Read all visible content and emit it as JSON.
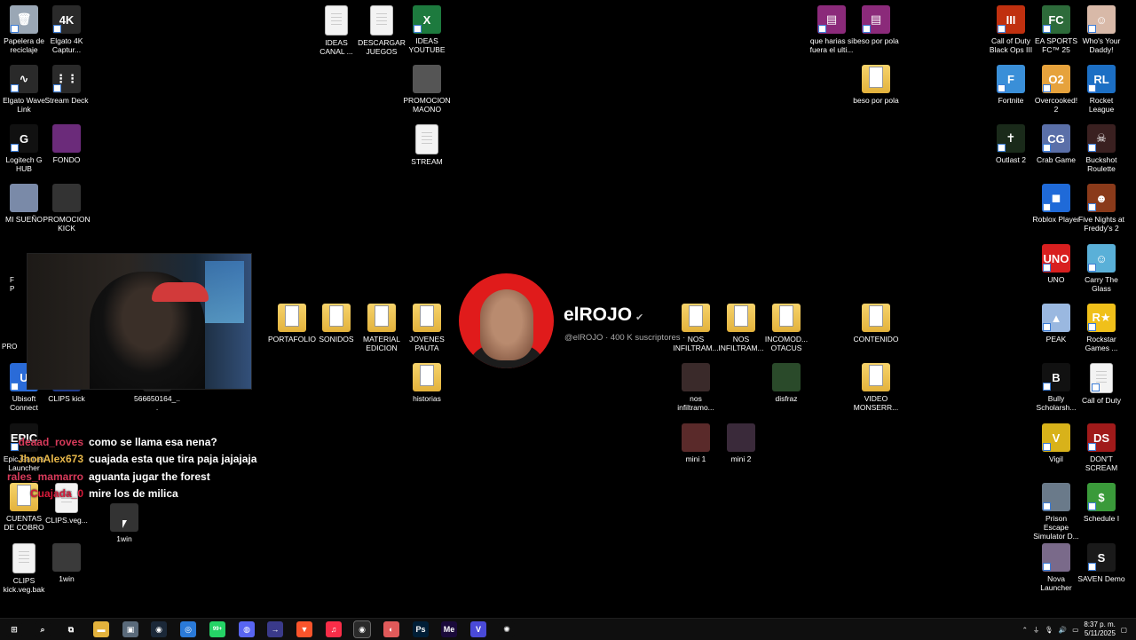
{
  "desktop_icons": [
    {
      "id": "recycle",
      "label": "Papelera de reciclaje",
      "icon": "recycle-bin-icon",
      "color": "#9aa7b5",
      "glyph": "🗑"
    },
    {
      "id": "elgato4k",
      "label": "Elgato 4K Captur...",
      "icon": "elgato-4k-icon",
      "color": "#2a2a2a",
      "glyph": "4K"
    },
    {
      "id": "ideascanal",
      "label": "IDEAS CANAL ...",
      "icon": "text-document-icon",
      "color": "#f3f3f3",
      "glyph": ""
    },
    {
      "id": "descargar",
      "label": "DESCARGAR JUEGOS",
      "icon": "text-document-icon",
      "color": "#f3f3f3",
      "glyph": ""
    },
    {
      "id": "ideasyt",
      "label": "IDEAS YOUTUBE",
      "icon": "excel-icon",
      "color": "#1d7a3e",
      "glyph": "X"
    },
    {
      "id": "quehar",
      "label": "que harias si fuera el ulti...",
      "icon": "winrar-icon",
      "color": "#8b2a7a",
      "glyph": "▤"
    },
    {
      "id": "beso1",
      "label": "beso por pola",
      "icon": "winrar-icon",
      "color": "#8b2a7a",
      "glyph": "▤"
    },
    {
      "id": "cod",
      "label": "Call of Duty Black Ops III",
      "icon": "cod-icon",
      "color": "#c0300f",
      "glyph": "III"
    },
    {
      "id": "easports",
      "label": "EA SPORTS FC™ 25",
      "icon": "ea-fc-icon",
      "color": "#2d6b3a",
      "glyph": "FC"
    },
    {
      "id": "whosdaddy",
      "label": "Who's Your Daddy!",
      "icon": "whos-daddy-icon",
      "color": "#d8b9a8",
      "glyph": "☺"
    },
    {
      "id": "wave",
      "label": "Elgato Wave Link",
      "icon": "elgato-wave-icon",
      "color": "#2a2a2a",
      "glyph": "∿"
    },
    {
      "id": "streamdeck",
      "label": "Stream Deck",
      "icon": "stream-deck-icon",
      "color": "#2a2a2a",
      "glyph": "⋮⋮"
    },
    {
      "id": "promomaono",
      "label": "PROMOCION MAONO",
      "icon": "video-icon",
      "color": "#555",
      "glyph": ""
    },
    {
      "id": "beso2",
      "label": "beso por pola",
      "icon": "folder-icon",
      "color": "#e3b23c",
      "glyph": ""
    },
    {
      "id": "fortnite",
      "label": "Fortnite",
      "icon": "fortnite-icon",
      "color": "#3a8fd8",
      "glyph": "F"
    },
    {
      "id": "overcooked",
      "label": "Overcooked! 2",
      "icon": "overcooked-icon",
      "color": "#e6a23c",
      "glyph": "O2"
    },
    {
      "id": "rocket",
      "label": "Rocket League",
      "icon": "rocket-league-icon",
      "color": "#1c6fc4",
      "glyph": "RL"
    },
    {
      "id": "logitech",
      "label": "Logitech G HUB",
      "icon": "logitech-icon",
      "color": "#111",
      "glyph": "G"
    },
    {
      "id": "fondo",
      "label": "FONDO",
      "icon": "image-icon",
      "color": "#6b2b7a",
      "glyph": ""
    },
    {
      "id": "stream",
      "label": "STREAM",
      "icon": "text-document-icon",
      "color": "#f3f3f3",
      "glyph": ""
    },
    {
      "id": "outlast",
      "label": "Outlast 2",
      "icon": "outlast-icon",
      "color": "#1a2a1a",
      "glyph": "✝"
    },
    {
      "id": "crab",
      "label": "Crab Game",
      "icon": "crab-game-icon",
      "color": "#5a6fa8",
      "glyph": "CG"
    },
    {
      "id": "buckshot",
      "label": "Buckshot Roulette",
      "icon": "buckshot-icon",
      "color": "#3a2020",
      "glyph": "☠"
    },
    {
      "id": "misueno",
      "label": "MI SUEÑO",
      "icon": "image-icon",
      "color": "#7a8aa8",
      "glyph": ""
    },
    {
      "id": "promokick",
      "label": "PROMOCION KICK",
      "icon": "video-icon",
      "color": "#333",
      "glyph": ""
    },
    {
      "id": "roblox",
      "label": "Roblox Player",
      "icon": "roblox-icon",
      "color": "#1f6ad8",
      "glyph": "◼"
    },
    {
      "id": "fnaf",
      "label": "Five Nights at Freddy's 2",
      "icon": "fnaf-icon",
      "color": "#8a3a1a",
      "glyph": "☻"
    },
    {
      "id": "uno",
      "label": "UNO",
      "icon": "uno-icon",
      "color": "#d81f1f",
      "glyph": "UNO"
    },
    {
      "id": "carry",
      "label": "Carry The Glass",
      "icon": "carry-glass-icon",
      "color": "#5ab0d8",
      "glyph": "☺"
    },
    {
      "id": "portafolio",
      "label": "PORTAFOLIO",
      "icon": "folder-icon",
      "color": "#e3b23c",
      "glyph": ""
    },
    {
      "id": "sonidos",
      "label": "SONIDOS",
      "icon": "folder-icon",
      "color": "#e3b23c",
      "glyph": ""
    },
    {
      "id": "material",
      "label": "MATERIAL EDICION",
      "icon": "folder-icon",
      "color": "#e3b23c",
      "glyph": ""
    },
    {
      "id": "jovenes",
      "label": "JOVENES PAUTA",
      "icon": "folder-icon",
      "color": "#e3b23c",
      "glyph": ""
    },
    {
      "id": "nos1",
      "label": "NOS INFILTRAM...",
      "icon": "folder-icon",
      "color": "#e3b23c",
      "glyph": ""
    },
    {
      "id": "nos2",
      "label": "NOS INFILTRAM...",
      "icon": "folder-icon",
      "color": "#e3b23c",
      "glyph": ""
    },
    {
      "id": "incomod",
      "label": "INCOMOD... OTACUS",
      "icon": "folder-icon",
      "color": "#e3b23c",
      "glyph": ""
    },
    {
      "id": "contenido",
      "label": "CONTENIDO",
      "icon": "folder-icon",
      "color": "#e3b23c",
      "glyph": ""
    },
    {
      "id": "peak",
      "label": "PEAK",
      "icon": "peak-icon",
      "color": "#9ab8e0",
      "glyph": "▲"
    },
    {
      "id": "rockstar",
      "label": "Rockstar Games ...",
      "icon": "rockstar-icon",
      "color": "#f0c01a",
      "glyph": "R★"
    },
    {
      "id": "historias",
      "label": "historias",
      "icon": "folder-icon",
      "color": "#e3b23c",
      "glyph": ""
    },
    {
      "id": "nosinf",
      "label": "nos infiltramo...",
      "icon": "video-icon",
      "color": "#3a2a2a",
      "glyph": ""
    },
    {
      "id": "disfraz",
      "label": "disfraz",
      "icon": "image-icon",
      "color": "#2a4a2a",
      "glyph": ""
    },
    {
      "id": "video",
      "label": "VIDEO MONSERR...",
      "icon": "folder-icon",
      "color": "#e3b23c",
      "glyph": ""
    },
    {
      "id": "bully",
      "label": "Bully Scholarsh...",
      "icon": "bully-icon",
      "color": "#111",
      "glyph": "B"
    },
    {
      "id": "codb",
      "label": "Call of Duty",
      "icon": "blank-file-icon",
      "color": "#f3f3f3",
      "glyph": ""
    },
    {
      "id": "ubisoft",
      "label": "Ubisoft Connect",
      "icon": "ubisoft-icon",
      "color": "#2a6bd8",
      "glyph": "U"
    },
    {
      "id": "clipskick",
      "label": "CLIPS kick",
      "icon": "video-icon",
      "color": "#1f3a8a",
      "glyph": ""
    },
    {
      "id": "n566",
      "label": "566650164_...",
      "icon": "image-icon",
      "color": "#222",
      "glyph": ""
    },
    {
      "id": "mini1",
      "label": "mini 1",
      "icon": "video-icon",
      "color": "#5a2a2a",
      "glyph": ""
    },
    {
      "id": "mini2",
      "label": "mini 2",
      "icon": "video-icon",
      "color": "#3a2a3a",
      "glyph": ""
    },
    {
      "id": "vigil",
      "label": "Vigil",
      "icon": "vigil-icon",
      "color": "#d8b21a",
      "glyph": "V"
    },
    {
      "id": "dontscream",
      "label": "DON'T SCREAM",
      "icon": "dont-scream-icon",
      "color": "#a01a1a",
      "glyph": "DS"
    },
    {
      "id": "epic",
      "label": "Epic Games Launcher",
      "icon": "epic-icon",
      "color": "#111",
      "glyph": "EPIC"
    },
    {
      "id": "cuentas",
      "label": "CUENTAS DE COBRO",
      "icon": "folder-icon",
      "color": "#e3b23c",
      "glyph": ""
    },
    {
      "id": "clipsveg",
      "label": "CLIPS.veg...",
      "icon": "blank-file-icon",
      "color": "#f3f3f3",
      "glyph": ""
    },
    {
      "id": "onewin",
      "label": "1win",
      "icon": "image-icon",
      "color": "#333",
      "glyph": ""
    },
    {
      "id": "prison",
      "label": "Prison Escape Simulator D...",
      "icon": "prison-icon",
      "color": "#6a7a8a",
      "glyph": ""
    },
    {
      "id": "schedule",
      "label": "Schedule I",
      "icon": "schedule-icon",
      "color": "#3a9a3a",
      "glyph": "$"
    },
    {
      "id": "clipsbak",
      "label": "CLIPS kick.veg.bak",
      "icon": "blank-file-icon",
      "color": "#f3f3f3",
      "glyph": ""
    },
    {
      "id": "onewin2",
      "label": "1win",
      "icon": "video-icon",
      "color": "#3a3a3a",
      "glyph": ""
    },
    {
      "id": "nova",
      "label": "Nova Launcher",
      "icon": "nova-icon",
      "color": "#7a6a8a",
      "glyph": ""
    },
    {
      "id": "saven",
      "label": "SAVEN Demo",
      "icon": "saven-icon",
      "color": "#1a1a1a",
      "glyph": "S"
    }
  ],
  "partial_labels": [
    {
      "id": "pf",
      "text": "F"
    },
    {
      "id": "pp",
      "text": "P"
    },
    {
      "id": "pro",
      "text": "PRO"
    }
  ],
  "profile": {
    "name": "elROJO",
    "verified": "✔",
    "subtitle": "@elROJO · 400 K suscriptores ·"
  },
  "chat": [
    {
      "user": "deaad_roves",
      "color": "#d83a5a",
      "message": "como se llama esa nena?"
    },
    {
      "user": "JhonAlex673",
      "color": "#e8b84a",
      "message": "cuajada esta que tira paja jajajaja"
    },
    {
      "user": "rales_mamarro",
      "color": "#d83a5a",
      "message": "aguanta jugar the forest"
    },
    {
      "user": "Cuajada_0",
      "color": "#d81a3a",
      "message": "mire los de milica"
    }
  ],
  "taskbar": {
    "apps": [
      {
        "id": "start",
        "icon": "windows-start-icon",
        "glyph": "⊞",
        "color": "#0f0f0f"
      },
      {
        "id": "search",
        "icon": "search-icon",
        "glyph": "⌕",
        "color": "#0f0f0f"
      },
      {
        "id": "taskview",
        "icon": "task-view-icon",
        "glyph": "⧉",
        "color": "#0f0f0f"
      },
      {
        "id": "explorer",
        "icon": "file-explorer-icon",
        "glyph": "▬",
        "color": "#e3b23c"
      },
      {
        "id": "app5",
        "icon": "app-icon",
        "glyph": "▣",
        "color": "#5a6a7a"
      },
      {
        "id": "steam",
        "icon": "steam-icon",
        "glyph": "◉",
        "color": "#1b2838"
      },
      {
        "id": "vpn",
        "icon": "vpn-icon",
        "glyph": "◎",
        "color": "#2a7ad8"
      },
      {
        "id": "whatsapp",
        "icon": "whatsapp-icon",
        "glyph": "99+",
        "color": "#25d366"
      },
      {
        "id": "discord",
        "icon": "discord-icon",
        "glyph": "◍",
        "color": "#5865f2"
      },
      {
        "id": "arrow",
        "icon": "arrow-app-icon",
        "glyph": "→",
        "color": "#3a3a8a"
      },
      {
        "id": "brave",
        "icon": "brave-icon",
        "glyph": "▼",
        "color": "#fb542b"
      },
      {
        "id": "music",
        "icon": "music-icon",
        "glyph": "♫",
        "color": "#fa2d48"
      },
      {
        "id": "obs",
        "icon": "obs-icon",
        "glyph": "◉",
        "color": "#2a2a2a"
      },
      {
        "id": "app14",
        "icon": "app-icon",
        "glyph": "◐",
        "color": "#e05a5a"
      },
      {
        "id": "photoshop",
        "icon": "photoshop-icon",
        "glyph": "Ps",
        "color": "#001e36"
      },
      {
        "id": "mediaenc",
        "icon": "media-encoder-icon",
        "glyph": "Me",
        "color": "#1a0a3a"
      },
      {
        "id": "vegas",
        "icon": "vegas-icon",
        "glyph": "V",
        "color": "#4a4ad8"
      },
      {
        "id": "chatgpt",
        "icon": "chatgpt-icon",
        "glyph": "✺",
        "color": "#0f0f0f"
      }
    ],
    "time": "8:37 p. m.",
    "date": "5/11/2025"
  }
}
